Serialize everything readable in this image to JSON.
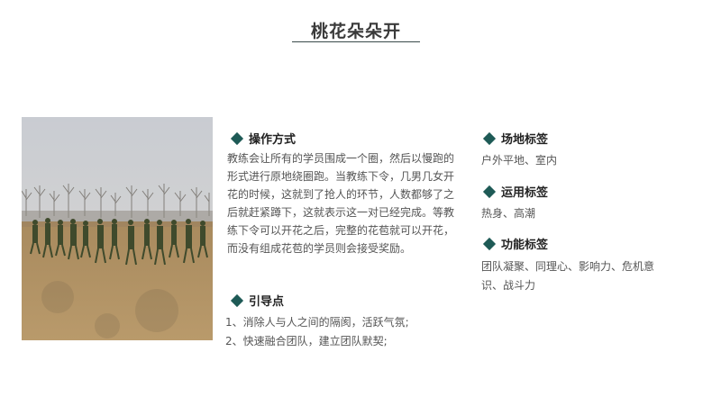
{
  "page_title": "桃花朵朵开",
  "colors": {
    "accent": "#1e5a56",
    "heading": "#222222",
    "body_text": "#555555"
  },
  "photo": {
    "icon": "outdoor-group-activity-photo"
  },
  "operation": {
    "heading": "操作方式",
    "lines": [
      "教练会让所有的学员围成一个圈，然后以慢跑的",
      "形式进行原地绕圈跑。当教练下令，几男几女开",
      "花的时候，这就到了抢人的环节，人数都够了之",
      "后就赶紧蹲下，这就表示这一对已经完成。等教",
      "练下令可以开花之后，完整的花苞就可以开花，",
      "而没有组成花苞的学员则会接受奖励。"
    ]
  },
  "guide": {
    "heading": "引导点",
    "items": [
      "1、消除人与人之间的隔阂，活跃气氛;",
      "2、快速融合团队，建立团队默契;"
    ]
  },
  "venue": {
    "heading": "场地标签",
    "text": "户外平地、室内"
  },
  "usage": {
    "heading": "运用标签",
    "text": "热身、高潮"
  },
  "function": {
    "heading": "功能标签",
    "lines": [
      "团队凝聚、同理心、影响力、危机意",
      "识、战斗力"
    ]
  }
}
